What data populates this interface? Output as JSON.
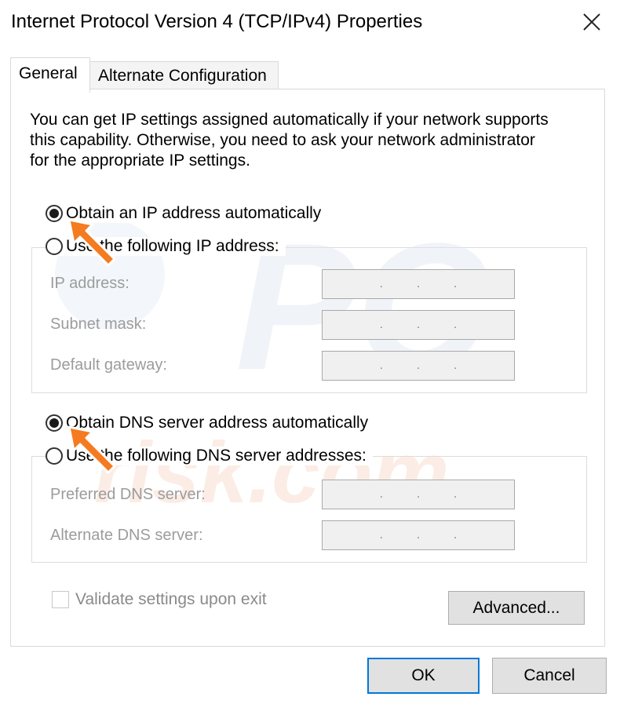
{
  "window": {
    "title": "Internet Protocol Version 4 (TCP/IPv4) Properties"
  },
  "tabs": [
    {
      "label": "General",
      "active": true
    },
    {
      "label": "Alternate Configuration",
      "active": false
    }
  ],
  "general": {
    "intro_lines": [
      "You can get IP settings assigned automatically if your network supports",
      "this capability. Otherwise, you need to ask your network administrator",
      "for the appropriate IP settings."
    ],
    "ip_auto_label": "Obtain an IP address automatically",
    "ip_manual_label": "Use the following IP address:",
    "ip_fields": [
      {
        "label": "IP address:",
        "value": ".   .   ."
      },
      {
        "label": "Subnet mask:",
        "value": ".   .   ."
      },
      {
        "label": "Default gateway:",
        "value": ".   .   ."
      }
    ],
    "dns_auto_label": "Obtain DNS server address automatically",
    "dns_manual_label": "Use the following DNS server addresses:",
    "dns_fields": [
      {
        "label": "Preferred DNS server:",
        "value": ".   .   ."
      },
      {
        "label": "Alternate DNS server:",
        "value": ".   .   ."
      }
    ],
    "validate_label": "Validate settings upon exit",
    "advanced_label": "Advanced..."
  },
  "buttons": {
    "ok": "OK",
    "cancel": "Cancel"
  },
  "colors": {
    "arrow": "#f47b20",
    "ok_border": "#0078d7",
    "disabled_text": "#9c9c9c"
  },
  "icons": {
    "close": "close-icon",
    "annotation": "arrow-pointer-icon"
  }
}
